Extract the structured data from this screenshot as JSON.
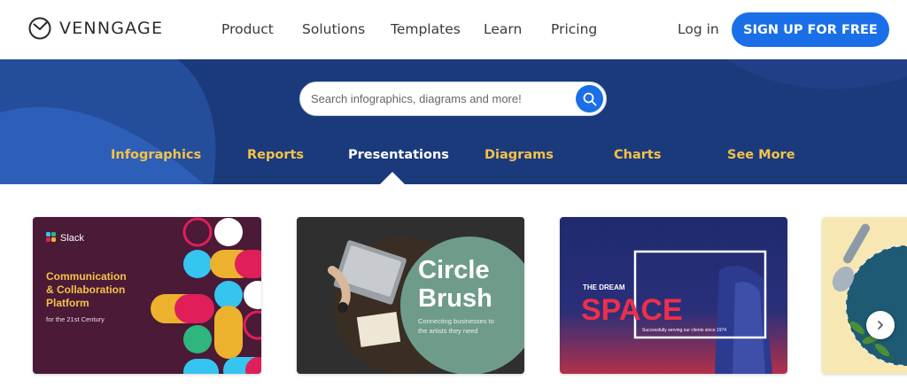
{
  "brand": {
    "name": "VENNGAGE"
  },
  "nav": {
    "items": [
      "Product",
      "Solutions",
      "Templates",
      "Learn",
      "Pricing"
    ],
    "login": "Log in",
    "signup": "SIGN UP FOR FREE"
  },
  "search": {
    "placeholder": "Search infographics, diagrams and more!"
  },
  "categories": {
    "items": [
      "Infographics",
      "Reports",
      "Presentations",
      "Diagrams",
      "Charts",
      "See More"
    ],
    "active": "Presentations"
  },
  "cards": [
    {
      "badge": "Slack",
      "title": [
        "Communication",
        "& Collaboration",
        "Platform"
      ],
      "subtitle": "for the 21st Century"
    },
    {
      "title": [
        "Circle",
        "Brush"
      ],
      "subtitle": [
        "Connecting businesses to",
        "the artists they need"
      ]
    },
    {
      "kicker": "THE DREAM",
      "title": "SPACE",
      "subtitle": "Successfully serving our clients since 1974"
    },
    {}
  ],
  "colors": {
    "brand_blue": "#1a6fe8",
    "hero_bg": "#1b3a7c",
    "category_yellow": "#f4c248"
  },
  "icons": {
    "logo": "venngage-logo-icon",
    "search": "search-icon",
    "next": "chevron-right-icon"
  }
}
